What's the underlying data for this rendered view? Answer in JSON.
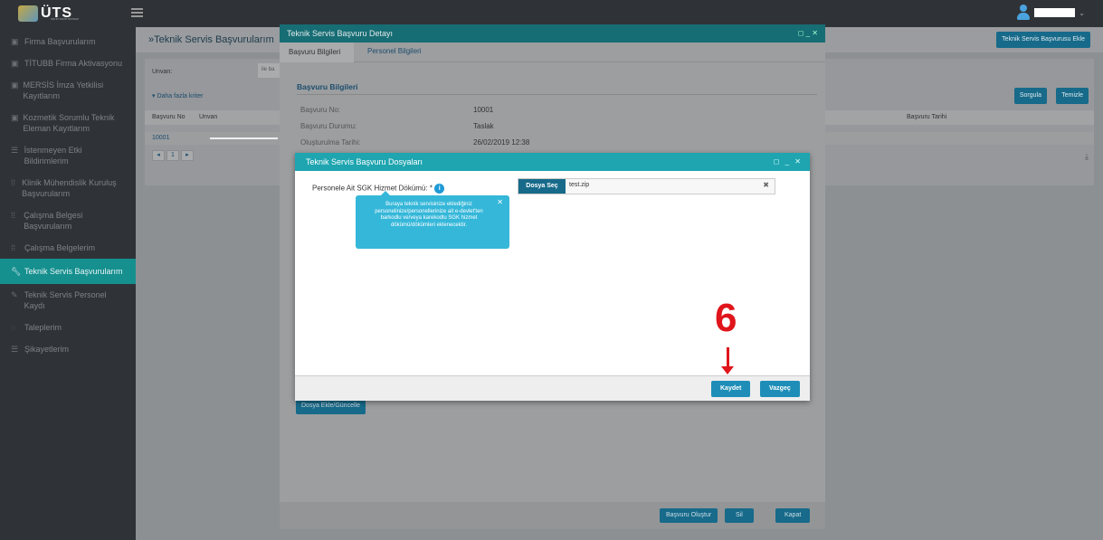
{
  "topbar": {
    "logo_text": "ÜTS",
    "logo_sub": "ÜRÜN TAKİP SİSTEMİ"
  },
  "sidebar": {
    "items": [
      {
        "label": "Firma Başvurularım",
        "icon": "doc-icon"
      },
      {
        "label": "TİTUBB Firma Aktivasyonu",
        "icon": "doc-icon"
      },
      {
        "label": "MERSİS İmza Yetkilisi Kayıtlarım",
        "icon": "doc-icon"
      },
      {
        "label": "Kozmetik Sorumlu Teknik Eleman Kayıtlarım",
        "icon": "doc-icon"
      },
      {
        "label": "İstenmeyen Etki Bildirimlerim",
        "icon": "list-icon"
      },
      {
        "label": "Klinik Mühendislik Kuruluş Başvurularım",
        "icon": "grid-icon"
      },
      {
        "label": "Çalışma Belgesi Başvurularım",
        "icon": "grid-icon"
      },
      {
        "label": "Çalışma Belgelerim",
        "icon": "grid-icon"
      },
      {
        "label": "Teknik Servis Başvurularım",
        "icon": "wrench-icon",
        "active": true
      },
      {
        "label": "Teknik Servis Personel Kaydı",
        "icon": "pencil-icon"
      },
      {
        "label": "Taleplerim",
        "icon": "chat-icon"
      },
      {
        "label": "Şikayetlerim",
        "icon": "list-icon"
      }
    ]
  },
  "main": {
    "title": "»Teknik Servis Başvurularım",
    "add_button": "Teknik Servis Başvurusu Ekle",
    "filter_unvan_label": "Unvan:",
    "filter_unvan_placeholder": "ile ba",
    "more_criteria": "Daha fazla kriter",
    "search_button": "Sorgula",
    "clear_button": "Temizle",
    "grid_headers": [
      "Başvuru No",
      "Unvan",
      "Başvuru Tarihi"
    ],
    "grid_rows": [
      {
        "no": "10001"
      }
    ],
    "pager_current": "1"
  },
  "detail_modal": {
    "title": "Teknik Servis Başvuru Detayı",
    "tabs": [
      "Başvuru Bilgileri",
      "Personel Bilgileri"
    ],
    "section_title": "Başvuru Bilgileri",
    "fields": [
      {
        "label": "Başvuru No:",
        "value": "10001"
      },
      {
        "label": "Başvuru Durumu:",
        "value": "Taslak"
      },
      {
        "label": "Oluşturulma Tarihi:",
        "value": "26/02/2019 12:38"
      }
    ],
    "upload_button": "Dosya Ekle/Güncelle",
    "footer_buttons": [
      "Başvuru Oluştur",
      "Sil",
      "Kapat"
    ]
  },
  "files_modal": {
    "title": "Teknik Servis Başvuru Dosyaları",
    "field_label": "Personele Ait SGK Hizmet Dökümü: *",
    "tooltip": "Buraya teknik servisinize eklediğiniz personelinize/personellerinize ait e-devlet'ten barkodlu ve/veya karekodlu SGK hizmet dökümü/dökümleri eklenecektir.",
    "choose_button": "Dosya Seç",
    "file_name": "test.zip",
    "save_button": "Kaydet",
    "cancel_button": "Vazgeç"
  },
  "annotation": {
    "step": "6",
    "color": "#e0151b"
  }
}
